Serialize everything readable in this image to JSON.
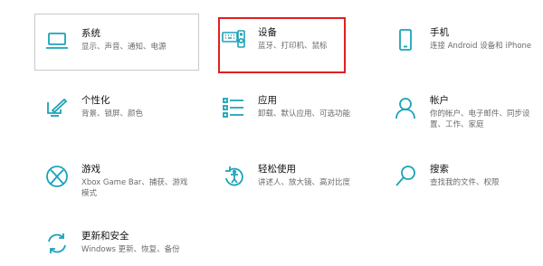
{
  "tiles": [
    {
      "title": "系统",
      "desc": [
        "显示、声音、通知、电源"
      ],
      "icon": "laptop-icon"
    },
    {
      "title": "设备",
      "desc": [
        "蓝牙、打印机、鼠标"
      ],
      "icon": "keyboard-speaker-icon"
    },
    {
      "title": "手机",
      "desc": [
        "连接 Android 设备和 iPhone"
      ],
      "icon": "phone-icon"
    },
    {
      "title": "个性化",
      "desc": [
        "背景、锁屏、颜色"
      ],
      "icon": "paint-icon"
    },
    {
      "title": "应用",
      "desc": [
        "卸载、默认应用、可选功能"
      ],
      "icon": "apps-list-icon"
    },
    {
      "title": "帐户",
      "desc": [
        "你的帐户、电子邮件、同步设",
        "置、工作、家庭"
      ],
      "icon": "person-icon"
    },
    {
      "title": "游戏",
      "desc": [
        "Xbox Game Bar、捕获、游戏",
        "模式"
      ],
      "icon": "xbox-icon"
    },
    {
      "title": "轻松使用",
      "desc": [
        "讲述人、放大镜、高对比度"
      ],
      "icon": "ease-of-access-icon"
    },
    {
      "title": "搜索",
      "desc": [
        "查找我的文件、权限"
      ],
      "icon": "search-icon"
    },
    {
      "title": "更新和安全",
      "desc": [
        "Windows 更新、恢复、备份"
      ],
      "icon": "update-icon"
    }
  ],
  "colors": {
    "accent": "#1aa3b8",
    "highlight": "#e02020"
  }
}
